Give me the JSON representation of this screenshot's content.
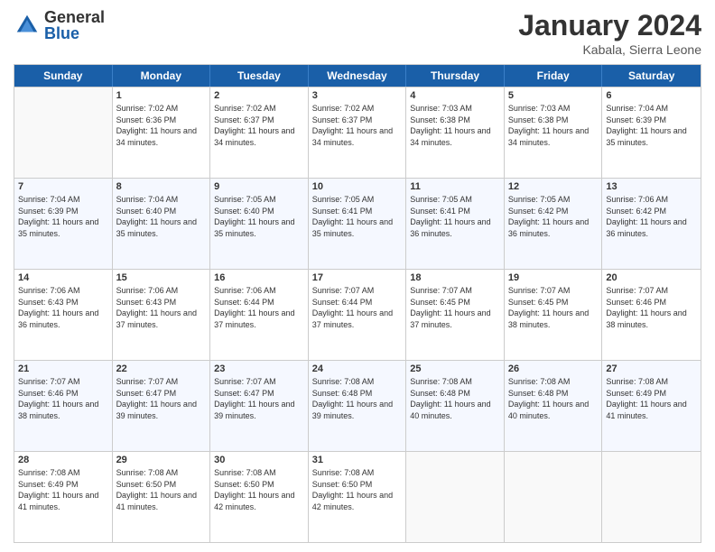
{
  "logo": {
    "general": "General",
    "blue": "Blue"
  },
  "title": "January 2024",
  "location": "Kabala, Sierra Leone",
  "days_of_week": [
    "Sunday",
    "Monday",
    "Tuesday",
    "Wednesday",
    "Thursday",
    "Friday",
    "Saturday"
  ],
  "weeks": [
    [
      {
        "day": "",
        "empty": true
      },
      {
        "day": "1",
        "sunrise": "Sunrise: 7:02 AM",
        "sunset": "Sunset: 6:36 PM",
        "daylight": "Daylight: 11 hours and 34 minutes."
      },
      {
        "day": "2",
        "sunrise": "Sunrise: 7:02 AM",
        "sunset": "Sunset: 6:37 PM",
        "daylight": "Daylight: 11 hours and 34 minutes."
      },
      {
        "day": "3",
        "sunrise": "Sunrise: 7:02 AM",
        "sunset": "Sunset: 6:37 PM",
        "daylight": "Daylight: 11 hours and 34 minutes."
      },
      {
        "day": "4",
        "sunrise": "Sunrise: 7:03 AM",
        "sunset": "Sunset: 6:38 PM",
        "daylight": "Daylight: 11 hours and 34 minutes."
      },
      {
        "day": "5",
        "sunrise": "Sunrise: 7:03 AM",
        "sunset": "Sunset: 6:38 PM",
        "daylight": "Daylight: 11 hours and 34 minutes."
      },
      {
        "day": "6",
        "sunrise": "Sunrise: 7:04 AM",
        "sunset": "Sunset: 6:39 PM",
        "daylight": "Daylight: 11 hours and 35 minutes."
      }
    ],
    [
      {
        "day": "7",
        "sunrise": "Sunrise: 7:04 AM",
        "sunset": "Sunset: 6:39 PM",
        "daylight": "Daylight: 11 hours and 35 minutes."
      },
      {
        "day": "8",
        "sunrise": "Sunrise: 7:04 AM",
        "sunset": "Sunset: 6:40 PM",
        "daylight": "Daylight: 11 hours and 35 minutes."
      },
      {
        "day": "9",
        "sunrise": "Sunrise: 7:05 AM",
        "sunset": "Sunset: 6:40 PM",
        "daylight": "Daylight: 11 hours and 35 minutes."
      },
      {
        "day": "10",
        "sunrise": "Sunrise: 7:05 AM",
        "sunset": "Sunset: 6:41 PM",
        "daylight": "Daylight: 11 hours and 35 minutes."
      },
      {
        "day": "11",
        "sunrise": "Sunrise: 7:05 AM",
        "sunset": "Sunset: 6:41 PM",
        "daylight": "Daylight: 11 hours and 36 minutes."
      },
      {
        "day": "12",
        "sunrise": "Sunrise: 7:05 AM",
        "sunset": "Sunset: 6:42 PM",
        "daylight": "Daylight: 11 hours and 36 minutes."
      },
      {
        "day": "13",
        "sunrise": "Sunrise: 7:06 AM",
        "sunset": "Sunset: 6:42 PM",
        "daylight": "Daylight: 11 hours and 36 minutes."
      }
    ],
    [
      {
        "day": "14",
        "sunrise": "Sunrise: 7:06 AM",
        "sunset": "Sunset: 6:43 PM",
        "daylight": "Daylight: 11 hours and 36 minutes."
      },
      {
        "day": "15",
        "sunrise": "Sunrise: 7:06 AM",
        "sunset": "Sunset: 6:43 PM",
        "daylight": "Daylight: 11 hours and 37 minutes."
      },
      {
        "day": "16",
        "sunrise": "Sunrise: 7:06 AM",
        "sunset": "Sunset: 6:44 PM",
        "daylight": "Daylight: 11 hours and 37 minutes."
      },
      {
        "day": "17",
        "sunrise": "Sunrise: 7:07 AM",
        "sunset": "Sunset: 6:44 PM",
        "daylight": "Daylight: 11 hours and 37 minutes."
      },
      {
        "day": "18",
        "sunrise": "Sunrise: 7:07 AM",
        "sunset": "Sunset: 6:45 PM",
        "daylight": "Daylight: 11 hours and 37 minutes."
      },
      {
        "day": "19",
        "sunrise": "Sunrise: 7:07 AM",
        "sunset": "Sunset: 6:45 PM",
        "daylight": "Daylight: 11 hours and 38 minutes."
      },
      {
        "day": "20",
        "sunrise": "Sunrise: 7:07 AM",
        "sunset": "Sunset: 6:46 PM",
        "daylight": "Daylight: 11 hours and 38 minutes."
      }
    ],
    [
      {
        "day": "21",
        "sunrise": "Sunrise: 7:07 AM",
        "sunset": "Sunset: 6:46 PM",
        "daylight": "Daylight: 11 hours and 38 minutes."
      },
      {
        "day": "22",
        "sunrise": "Sunrise: 7:07 AM",
        "sunset": "Sunset: 6:47 PM",
        "daylight": "Daylight: 11 hours and 39 minutes."
      },
      {
        "day": "23",
        "sunrise": "Sunrise: 7:07 AM",
        "sunset": "Sunset: 6:47 PM",
        "daylight": "Daylight: 11 hours and 39 minutes."
      },
      {
        "day": "24",
        "sunrise": "Sunrise: 7:08 AM",
        "sunset": "Sunset: 6:48 PM",
        "daylight": "Daylight: 11 hours and 39 minutes."
      },
      {
        "day": "25",
        "sunrise": "Sunrise: 7:08 AM",
        "sunset": "Sunset: 6:48 PM",
        "daylight": "Daylight: 11 hours and 40 minutes."
      },
      {
        "day": "26",
        "sunrise": "Sunrise: 7:08 AM",
        "sunset": "Sunset: 6:48 PM",
        "daylight": "Daylight: 11 hours and 40 minutes."
      },
      {
        "day": "27",
        "sunrise": "Sunrise: 7:08 AM",
        "sunset": "Sunset: 6:49 PM",
        "daylight": "Daylight: 11 hours and 41 minutes."
      }
    ],
    [
      {
        "day": "28",
        "sunrise": "Sunrise: 7:08 AM",
        "sunset": "Sunset: 6:49 PM",
        "daylight": "Daylight: 11 hours and 41 minutes."
      },
      {
        "day": "29",
        "sunrise": "Sunrise: 7:08 AM",
        "sunset": "Sunset: 6:50 PM",
        "daylight": "Daylight: 11 hours and 41 minutes."
      },
      {
        "day": "30",
        "sunrise": "Sunrise: 7:08 AM",
        "sunset": "Sunset: 6:50 PM",
        "daylight": "Daylight: 11 hours and 42 minutes."
      },
      {
        "day": "31",
        "sunrise": "Sunrise: 7:08 AM",
        "sunset": "Sunset: 6:50 PM",
        "daylight": "Daylight: 11 hours and 42 minutes."
      },
      {
        "day": "",
        "empty": true
      },
      {
        "day": "",
        "empty": true
      },
      {
        "day": "",
        "empty": true
      }
    ]
  ]
}
